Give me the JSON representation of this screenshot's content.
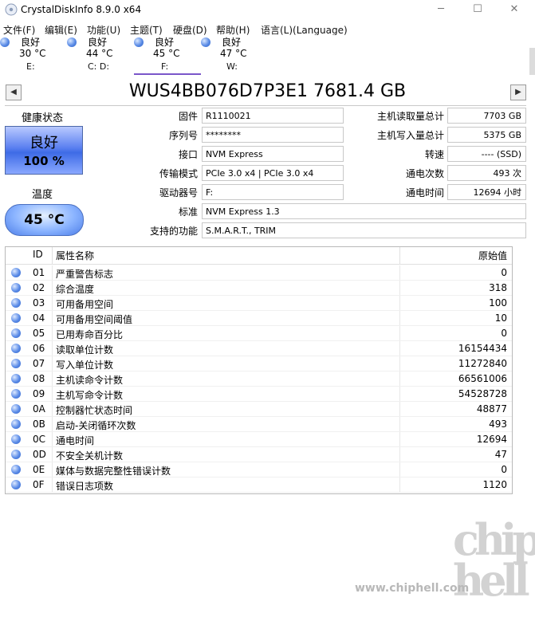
{
  "window": {
    "title": "CrystalDiskInfo 8.9.0 x64",
    "controls": {
      "minimize": "─",
      "maximize": "☐",
      "close": "✕"
    }
  },
  "menu": [
    "文件(F)",
    "编辑(E)",
    "功能(U)",
    "主题(T)",
    "硬盘(D)",
    "帮助(H)",
    "语言(L)(Language)"
  ],
  "drives": [
    {
      "status": "良好",
      "temp": "30 °C",
      "letter": "E:"
    },
    {
      "status": "良好",
      "temp": "44 °C",
      "letter": "C: D:"
    },
    {
      "status": "良好",
      "temp": "45 °C",
      "letter": "F:"
    },
    {
      "status": "良好",
      "temp": "47 °C",
      "letter": "W:"
    }
  ],
  "nav": {
    "prev": "◀",
    "next": "▶"
  },
  "model": "WUS4BB076D7P3E1 7681.4 GB",
  "health": {
    "label": "健康状态",
    "status": "良好",
    "percent": "100 %"
  },
  "temperature": {
    "label": "温度",
    "value": "45 °C"
  },
  "fields": {
    "firmware": {
      "label": "固件",
      "value": "R1110021"
    },
    "serial": {
      "label": "序列号",
      "value": "********"
    },
    "interface": {
      "label": "接口",
      "value": "NVM Express"
    },
    "transfer": {
      "label": "传输模式",
      "value": "PCIe 3.0 x4 | PCIe 3.0 x4"
    },
    "drive_letter": {
      "label": "驱动器号",
      "value": "F:"
    },
    "standard": {
      "label": "标准",
      "value": "NVM Express 1.3"
    },
    "features": {
      "label": "支持的功能",
      "value": "S.M.A.R.T., TRIM"
    },
    "host_reads": {
      "label": "主机读取量总计",
      "value": "7703 GB"
    },
    "host_writes": {
      "label": "主机写入量总计",
      "value": "5375 GB"
    },
    "rotation": {
      "label": "转速",
      "value": "---- (SSD)"
    },
    "power_on_count": {
      "label": "通电次数",
      "value": "493 次"
    },
    "power_on_hours": {
      "label": "通电时间",
      "value": "12694 小时"
    }
  },
  "table": {
    "headers": {
      "id": "ID",
      "name": "属性名称",
      "raw": "原始值"
    },
    "rows": [
      {
        "id": "01",
        "name": "严重警告标志",
        "raw": "0"
      },
      {
        "id": "02",
        "name": "综合温度",
        "raw": "318"
      },
      {
        "id": "03",
        "name": "可用备用空间",
        "raw": "100"
      },
      {
        "id": "04",
        "name": "可用备用空间阈值",
        "raw": "10"
      },
      {
        "id": "05",
        "name": "已用寿命百分比",
        "raw": "0"
      },
      {
        "id": "06",
        "name": "读取单位计数",
        "raw": "16154434"
      },
      {
        "id": "07",
        "name": "写入单位计数",
        "raw": "11272840"
      },
      {
        "id": "08",
        "name": "主机读命令计数",
        "raw": "66561006"
      },
      {
        "id": "09",
        "name": "主机写命令计数",
        "raw": "54528728"
      },
      {
        "id": "0A",
        "name": "控制器忙状态时间",
        "raw": "48877"
      },
      {
        "id": "0B",
        "name": "启动-关闭循环次数",
        "raw": "493"
      },
      {
        "id": "0C",
        "name": "通电时间",
        "raw": "12694"
      },
      {
        "id": "0D",
        "name": "不安全关机计数",
        "raw": "47"
      },
      {
        "id": "0E",
        "name": "媒体与数据完整性错误计数",
        "raw": "0"
      },
      {
        "id": "0F",
        "name": "错误日志项数",
        "raw": "1120"
      }
    ]
  },
  "watermark": {
    "url": "www.chiphell.com",
    "logo": "chip hell"
  },
  "colors": {
    "accent_tab": "#7a56c9",
    "health_blue": "#3e6be6",
    "status_ball": "#5a8be6"
  }
}
